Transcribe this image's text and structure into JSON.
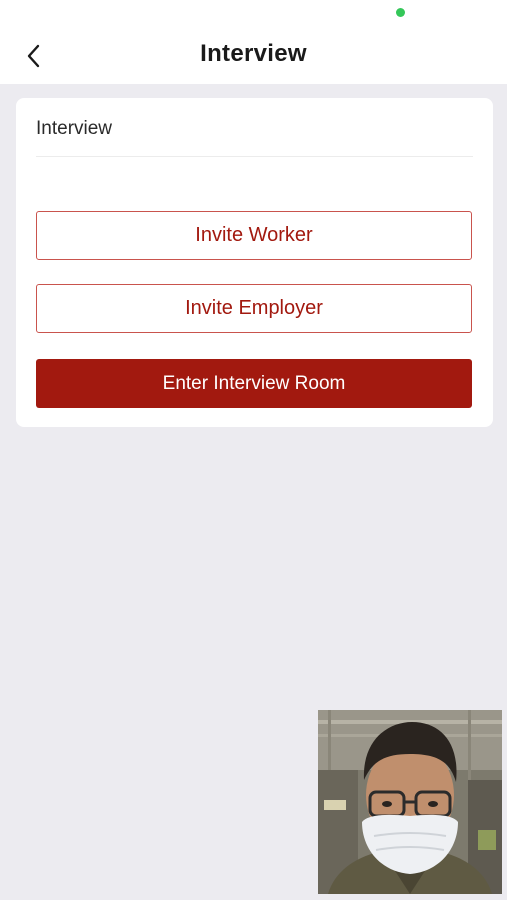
{
  "nav": {
    "title": "Interview"
  },
  "card": {
    "title": "Interview",
    "invite_worker_label": "Invite Worker",
    "invite_employer_label": "Invite Employer",
    "enter_room_label": "Enter Interview Room"
  },
  "colors": {
    "accent": "#a2190f",
    "outline_border": "#c9534d",
    "background": "#ecebf0",
    "status_dot": "#34c759"
  },
  "icons": {
    "back": "chevron-left-icon",
    "camera_indicator": "status-dot-icon",
    "video": "self-video-preview"
  }
}
